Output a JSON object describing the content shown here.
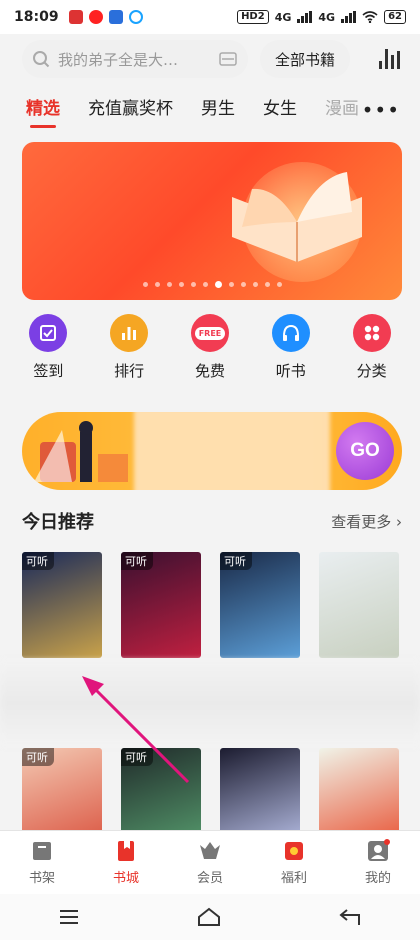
{
  "status": {
    "time": "18:09",
    "hd": "HD2",
    "net1": "4G",
    "net2": "4G",
    "battery": "62"
  },
  "search": {
    "placeholder": "我的弟子全是大…",
    "all_books": "全部书籍"
  },
  "tabs": [
    "精选",
    "充值赢奖杯",
    "男生",
    "女生",
    "漫画"
  ],
  "banner": {
    "dot_count": 12,
    "active_dot": 6
  },
  "quick_actions": [
    {
      "label": "签到",
      "color": "#7b3fe4",
      "icon": "checkin-icon"
    },
    {
      "label": "排行",
      "color": "#f5a623",
      "icon": "rank-icon"
    },
    {
      "label": "免费",
      "color": "#f23c52",
      "icon": "free-icon",
      "badge": "FREE"
    },
    {
      "label": "听书",
      "color": "#1f8fff",
      "icon": "headphones-icon"
    },
    {
      "label": "分类",
      "color": "#f23c52",
      "icon": "category-icon"
    }
  ],
  "promo": {
    "go_label": "GO"
  },
  "section": {
    "title": "今日推荐",
    "more": "查看更多"
  },
  "books_row1": [
    {
      "tag": "可听",
      "color1": "#1a2a5a",
      "color2": "#c9a24a"
    },
    {
      "tag": "可听",
      "color1": "#3a1030",
      "color2": "#c02040"
    },
    {
      "tag": "可听",
      "color1": "#1a2a48",
      "color2": "#5c9fd8"
    },
    {
      "tag": "",
      "color1": "#e9eef0",
      "color2": "#c8d0c0"
    }
  ],
  "books_row2": [
    {
      "tag": "可听",
      "color1": "#f3c9b3",
      "color2": "#d94e3a"
    },
    {
      "tag": "可听",
      "color1": "#202a2a",
      "color2": "#58a070"
    },
    {
      "tag": "",
      "color1": "#1c1c30",
      "color2": "#c0c8f0"
    },
    {
      "tag": "",
      "color1": "#f0f3e8",
      "color2": "#e84a2a"
    }
  ],
  "bottom_tabs": [
    {
      "label": "书架",
      "icon": "bookshelf-icon",
      "active": false
    },
    {
      "label": "书城",
      "icon": "bookstore-icon",
      "active": true
    },
    {
      "label": "会员",
      "icon": "vip-icon",
      "active": false
    },
    {
      "label": "福利",
      "icon": "gift-icon",
      "active": false
    },
    {
      "label": "我的",
      "icon": "profile-icon",
      "active": false
    }
  ],
  "colors": {
    "accent": "#e8332a"
  }
}
